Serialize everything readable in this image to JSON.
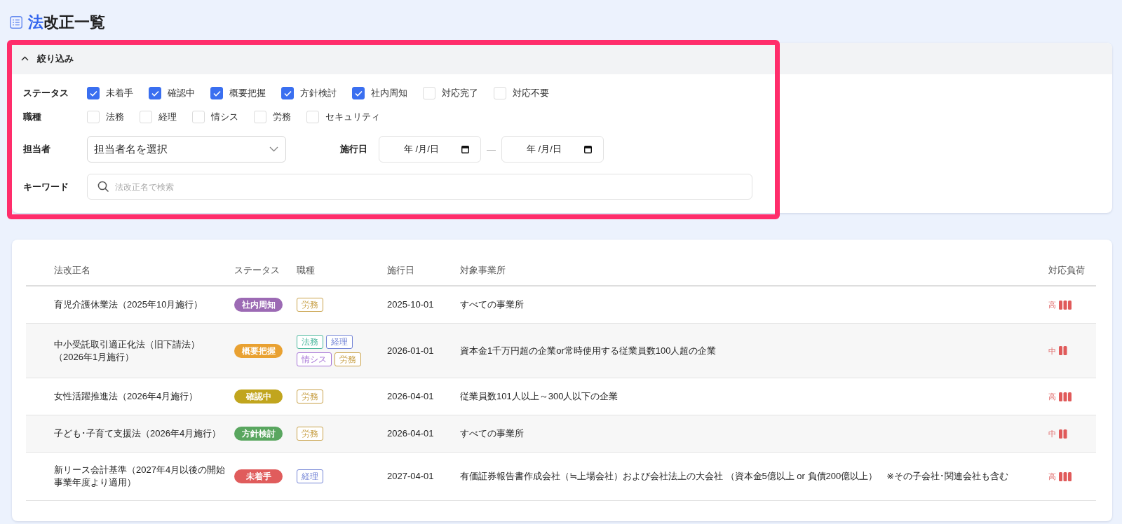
{
  "title": {
    "parts": [
      {
        "text": "法",
        "accent": true
      },
      {
        "text": "改正一覧",
        "accent": false
      }
    ]
  },
  "filter": {
    "title": "絞り込み",
    "expanded": true,
    "highlighted": true,
    "status": {
      "label": "ステータス",
      "options": [
        {
          "label": "未着手",
          "checked": true
        },
        {
          "label": "確認中",
          "checked": true
        },
        {
          "label": "概要把握",
          "checked": true
        },
        {
          "label": "方針検討",
          "checked": true
        },
        {
          "label": "社内周知",
          "checked": true
        },
        {
          "label": "対応完了",
          "checked": false
        },
        {
          "label": "対応不要",
          "checked": false
        }
      ]
    },
    "job_type": {
      "label": "職種",
      "options": [
        {
          "label": "法務",
          "checked": false
        },
        {
          "label": "経理",
          "checked": false
        },
        {
          "label": "情シス",
          "checked": false
        },
        {
          "label": "労務",
          "checked": false
        },
        {
          "label": "セキュリティ",
          "checked": false
        }
      ]
    },
    "assignee": {
      "label": "担当者",
      "placeholder": "担当者名を選択"
    },
    "effective_date": {
      "label": "施行日",
      "from": {
        "placeholder": "年 /月/日"
      },
      "separator": "—",
      "to": {
        "placeholder": "年 /月/日"
      }
    },
    "keyword": {
      "label": "キーワード",
      "placeholder": "法改正名で検索"
    }
  },
  "table": {
    "columns": [
      "法改正名",
      "ステータス",
      "職種",
      "施行日",
      "対象事業所",
      "対応負荷"
    ],
    "rows": [
      {
        "name": "育児介護休業法（2025年10月施行）",
        "status": {
          "label": "社内周知",
          "color": "#9c6ab4"
        },
        "job_types": [
          {
            "label": "労務",
            "color": "#c9a24a"
          }
        ],
        "effective_date": "2025-10-01",
        "target": "すべての事業所",
        "load": {
          "label": "高",
          "kind": "high"
        }
      },
      {
        "name": "中小受託取引適正化法（旧下請法）（2026年1月施行）",
        "status": {
          "label": "概要把握",
          "color": "#e9a131"
        },
        "job_types": [
          {
            "label": "法務",
            "color": "#4db89e"
          },
          {
            "label": "経理",
            "color": "#7384d6"
          },
          {
            "label": "情シス",
            "color": "#a672d6"
          },
          {
            "label": "労務",
            "color": "#c9a24a"
          }
        ],
        "effective_date": "2026-01-01",
        "target": "資本金1千万円超の企業or常時使用する従業員数100人超の企業",
        "load": {
          "label": "中",
          "kind": "medium"
        }
      },
      {
        "name": "女性活躍推進法（2026年4月施行）",
        "status": {
          "label": "確認中",
          "color": "#c1a51e"
        },
        "job_types": [
          {
            "label": "労務",
            "color": "#c9a24a"
          }
        ],
        "effective_date": "2026-04-01",
        "target": "従業員数101人以上～300人以下の企業",
        "load": {
          "label": "高",
          "kind": "high"
        }
      },
      {
        "name": "子ども･子育て支援法（2026年4月施行）",
        "status": {
          "label": "方針検討",
          "color": "#59a65f"
        },
        "job_types": [
          {
            "label": "労務",
            "color": "#c9a24a"
          }
        ],
        "effective_date": "2026-04-01",
        "target": "すべての事業所",
        "load": {
          "label": "中",
          "kind": "medium"
        }
      },
      {
        "name": "新リース会計基準（2027年4月以後の開始事業年度より適用）",
        "status": {
          "label": "未着手",
          "color": "#e05c5c"
        },
        "job_types": [
          {
            "label": "経理",
            "color": "#7384d6"
          }
        ],
        "effective_date": "2027-04-01",
        "target": "有価証券報告書作成会社（≒上場会社）および会社法上の大会社 （資本金5億以上 or 負債200億以上）　※その子会社･関連会社も含む",
        "load": {
          "label": "高",
          "kind": "high"
        }
      }
    ]
  }
}
